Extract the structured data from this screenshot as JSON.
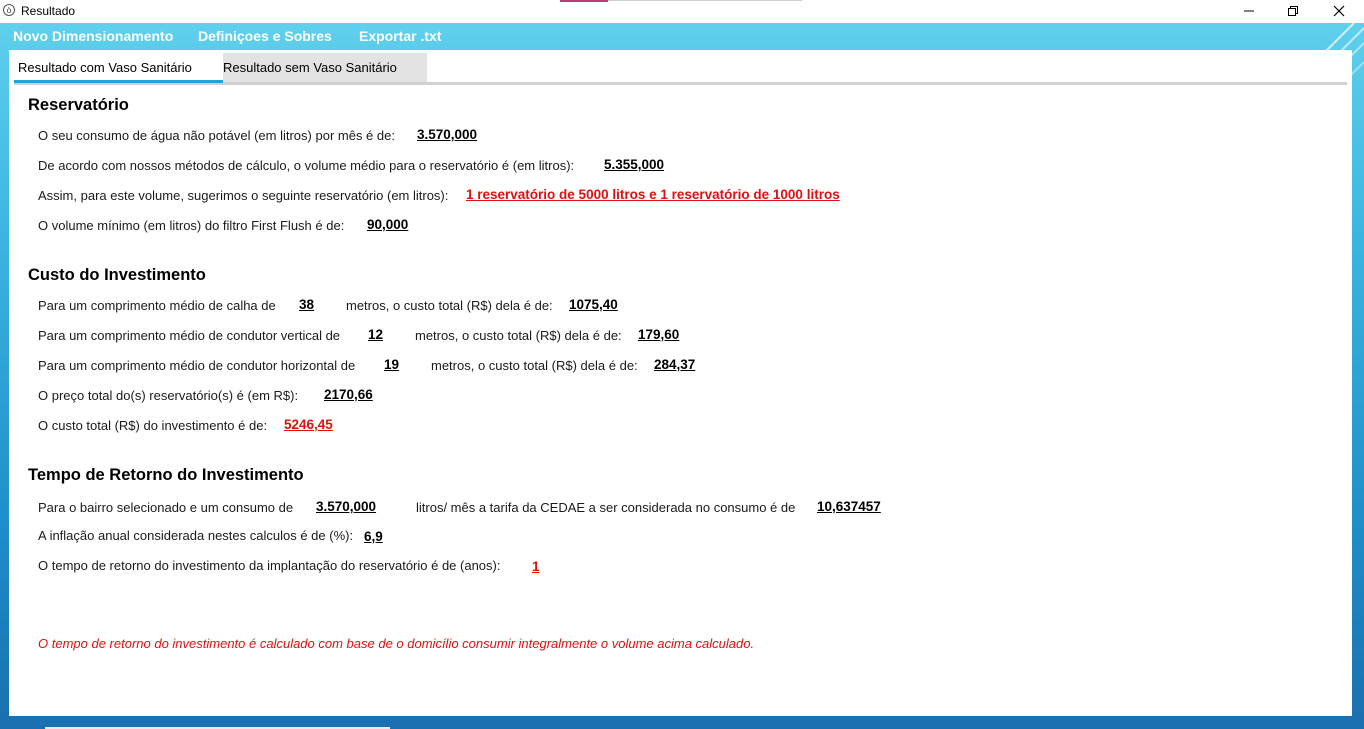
{
  "window": {
    "title": "Resultado",
    "app_icon": "ò"
  },
  "menu": {
    "items": [
      "Novo Dimensionamento",
      "Definiçoes e Sobres",
      "Exportar .txt"
    ]
  },
  "tabs": [
    "Resultado com Vaso Sanitário",
    "Resultado sem Vaso Sanitário"
  ],
  "reservatorio": {
    "title": "Reservatório",
    "consumo_label": "O seu consumo de água não potável (em litros) por mês é de:",
    "consumo_value": "3.570,000",
    "volume_label": "De acordo com nossos métodos de cálculo, o volume médio para o reservatório é (em litros):",
    "volume_value": "5.355,000",
    "sugestao_label": "Assim, para este volume, sugerimos o seguinte reservatório (em litros):",
    "sugestao_value": "1 reservatório de 5000 litros e 1 reservatório de 1000 litros",
    "filtro_label": "O volume mínimo (em litros) do filtro First Flush é de:",
    "filtro_value": "90,000"
  },
  "custo": {
    "title": "Custo do Investimento",
    "calha_label": "Para um comprimento médio de calha de",
    "calha_len": "38",
    "calha_label2": "metros, o custo total (R$) dela é de:",
    "calha_cost": "1075,40",
    "vertical_label": "Para um comprimento médio de condutor vertical de",
    "vertical_len": "12",
    "vertical_label2": "metros, o custo total (R$) dela é de:",
    "vertical_cost": "179,60",
    "horizontal_label": "Para um comprimento médio de condutor horizontal de",
    "horizontal_len": "19",
    "horizontal_label2": "metros, o custo total (R$) dela é de:",
    "horizontal_cost": "284,37",
    "reservatorio_label": "O preço total do(s) reservatório(s) é (em R$):",
    "reservatorio_value": "2170,66",
    "total_label": "O custo total (R$) do investimento é de:",
    "total_value": "5246,45"
  },
  "retorno": {
    "title": "Tempo de Retorno do Investimento",
    "bairro_label": "Para o bairro selecionado e um consumo de",
    "bairro_consumo": "3.570,000",
    "bairro_label2": "litros/ mês a tarifa da CEDAE a ser considerada no consumo é de",
    "tarifa_value": "10,637457",
    "inflacao_label": "A inflação anual considerada nestes calculos é de (%):",
    "inflacao_value": "6,9",
    "tempo_label": "O tempo de retorno do investimento da implantação do reservatório é de (anos):",
    "tempo_value": "1"
  },
  "note": "O tempo de retorno do investimento é calculado com base de o domicílio consumir integralmente o volume acima calculado.",
  "colors": {
    "frame_top": "#5fd0ec",
    "frame_bottom": "#1a6fb0",
    "highlight_red": "#e01010",
    "tab_accent": "#2aa1d6"
  }
}
